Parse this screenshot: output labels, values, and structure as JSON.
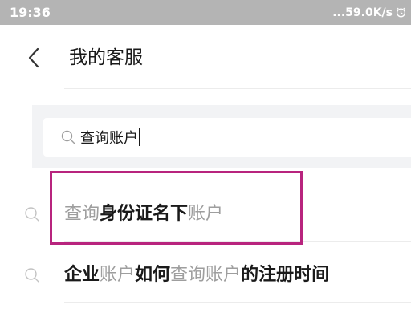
{
  "status_bar": {
    "time": "19:36",
    "network_speed": "...59.0K/s",
    "icons": [
      "alarm-icon"
    ]
  },
  "header": {
    "back_icon": "chevron-left-icon",
    "title": "我的客服"
  },
  "search": {
    "icon": "search-icon",
    "value": "查询账户"
  },
  "suggestions": [
    {
      "icon": "search-icon",
      "segments": [
        {
          "text": "查询",
          "match": true
        },
        {
          "text": "身份证名下",
          "match": false
        },
        {
          "text": "账户",
          "match": true
        }
      ]
    },
    {
      "icon": "search-icon",
      "segments": [
        {
          "text": "企业",
          "match": false
        },
        {
          "text": "账户",
          "match": true
        },
        {
          "text": "如何",
          "match": false
        },
        {
          "text": "查询账户",
          "match": true
        },
        {
          "text": "的注册时间",
          "match": false
        }
      ]
    }
  ],
  "colors": {
    "status_bar_bg": "#b4b4b4",
    "highlight_box": "#b8247e",
    "match_text": "#9e9e9e",
    "normal_text": "#1a1a1a"
  }
}
